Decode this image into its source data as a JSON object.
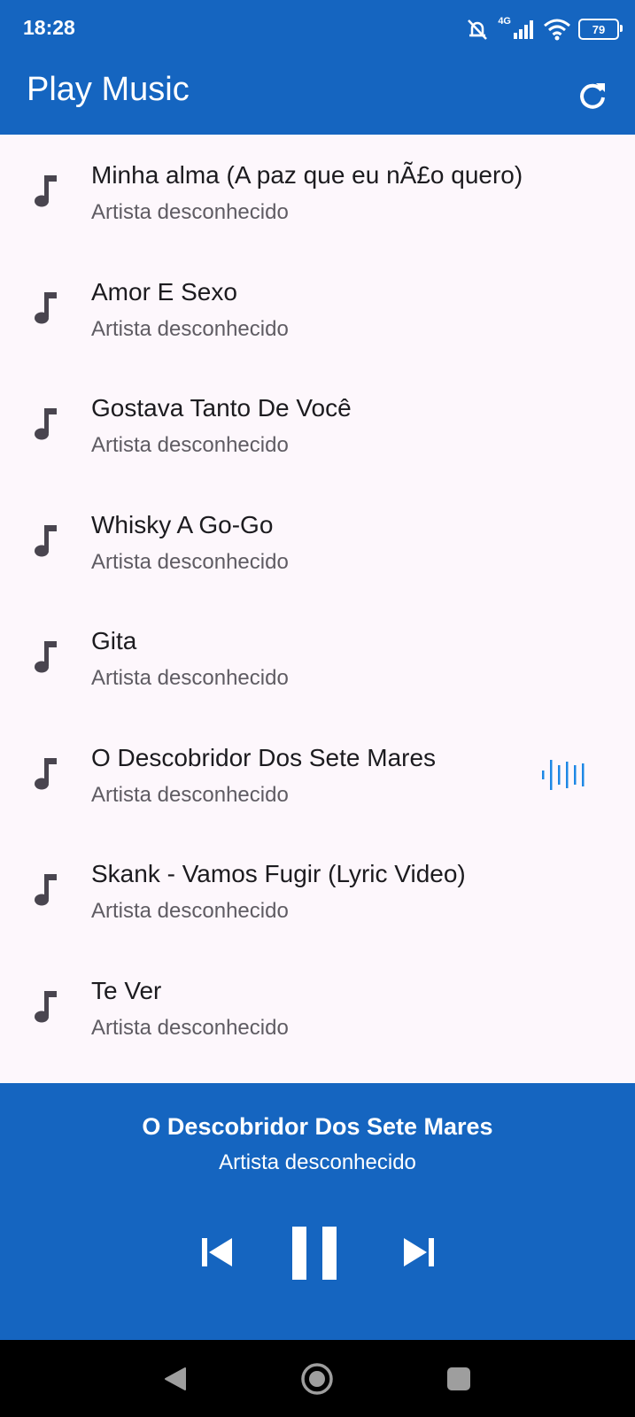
{
  "status": {
    "time": "18:28",
    "network": "4G",
    "battery": "79"
  },
  "app_bar": {
    "title": "Play Music",
    "refresh_icon": "refresh-icon"
  },
  "songs": [
    {
      "title": "Minha alma (A paz que eu nÃ£o quero)",
      "artist": "Artista desconhecido",
      "playing": false
    },
    {
      "title": "Amor E Sexo",
      "artist": "Artista desconhecido",
      "playing": false
    },
    {
      "title": "Gostava Tanto De Você",
      "artist": "Artista desconhecido",
      "playing": false
    },
    {
      "title": "Whisky A Go-Go",
      "artist": "Artista desconhecido",
      "playing": false
    },
    {
      "title": "Gita",
      "artist": "Artista desconhecido",
      "playing": false
    },
    {
      "title": "O Descobridor Dos Sete Mares",
      "artist": "Artista desconhecido",
      "playing": true
    },
    {
      "title": "Skank - Vamos Fugir (Lyric Video)",
      "artist": "Artista desconhecido",
      "playing": false
    },
    {
      "title": "Te Ver",
      "artist": "Artista desconhecido",
      "playing": false
    }
  ],
  "player": {
    "title": "O Descobridor Dos Sete Mares",
    "artist": "Artista desconhecido",
    "controls": [
      "skip-previous-icon",
      "pause-icon",
      "skip-next-icon"
    ]
  },
  "nav": [
    "back-icon",
    "home-icon",
    "recents-icon"
  ],
  "colors": {
    "primary": "#1565c0",
    "background": "#fdf7fc",
    "playing_indicator": "#1e88e5"
  }
}
